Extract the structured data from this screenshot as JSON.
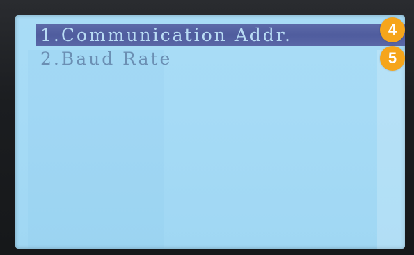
{
  "screen": {
    "menu": [
      {
        "label": "1.Communication Addr.",
        "selected": true
      },
      {
        "label": "2.Baud Rate",
        "selected": false
      }
    ]
  },
  "callouts": [
    "4",
    "5"
  ],
  "colors": {
    "lcd_background": "#a6dbf6",
    "selection_bar": "#5563a3",
    "selected_text": "#b9dcf4",
    "normal_text": "#6b8fb3",
    "callout_badge": "#f6a51b"
  }
}
